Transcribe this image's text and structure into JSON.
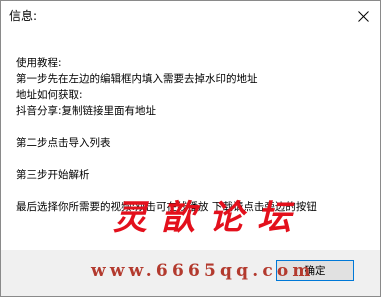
{
  "window": {
    "title": "信息:"
  },
  "message": {
    "lines": [
      "使用教程:",
      "第一步先在左边的编辑框内填入需要去掉水印的地址",
      "地址如何获取:",
      "抖音分享:复制链接里面有地址",
      "第二步点击导入列表",
      "第三步开始解析",
      "最后选择你所需要的视频:双击可在线播放 下载请点击旁边的按钮"
    ]
  },
  "buttons": {
    "ok_label": "确定"
  },
  "watermark": {
    "brand": "灵歆论坛",
    "url": "www.6665qq.com",
    "color": "#e3101c"
  },
  "icons": {
    "close": "close-icon"
  }
}
